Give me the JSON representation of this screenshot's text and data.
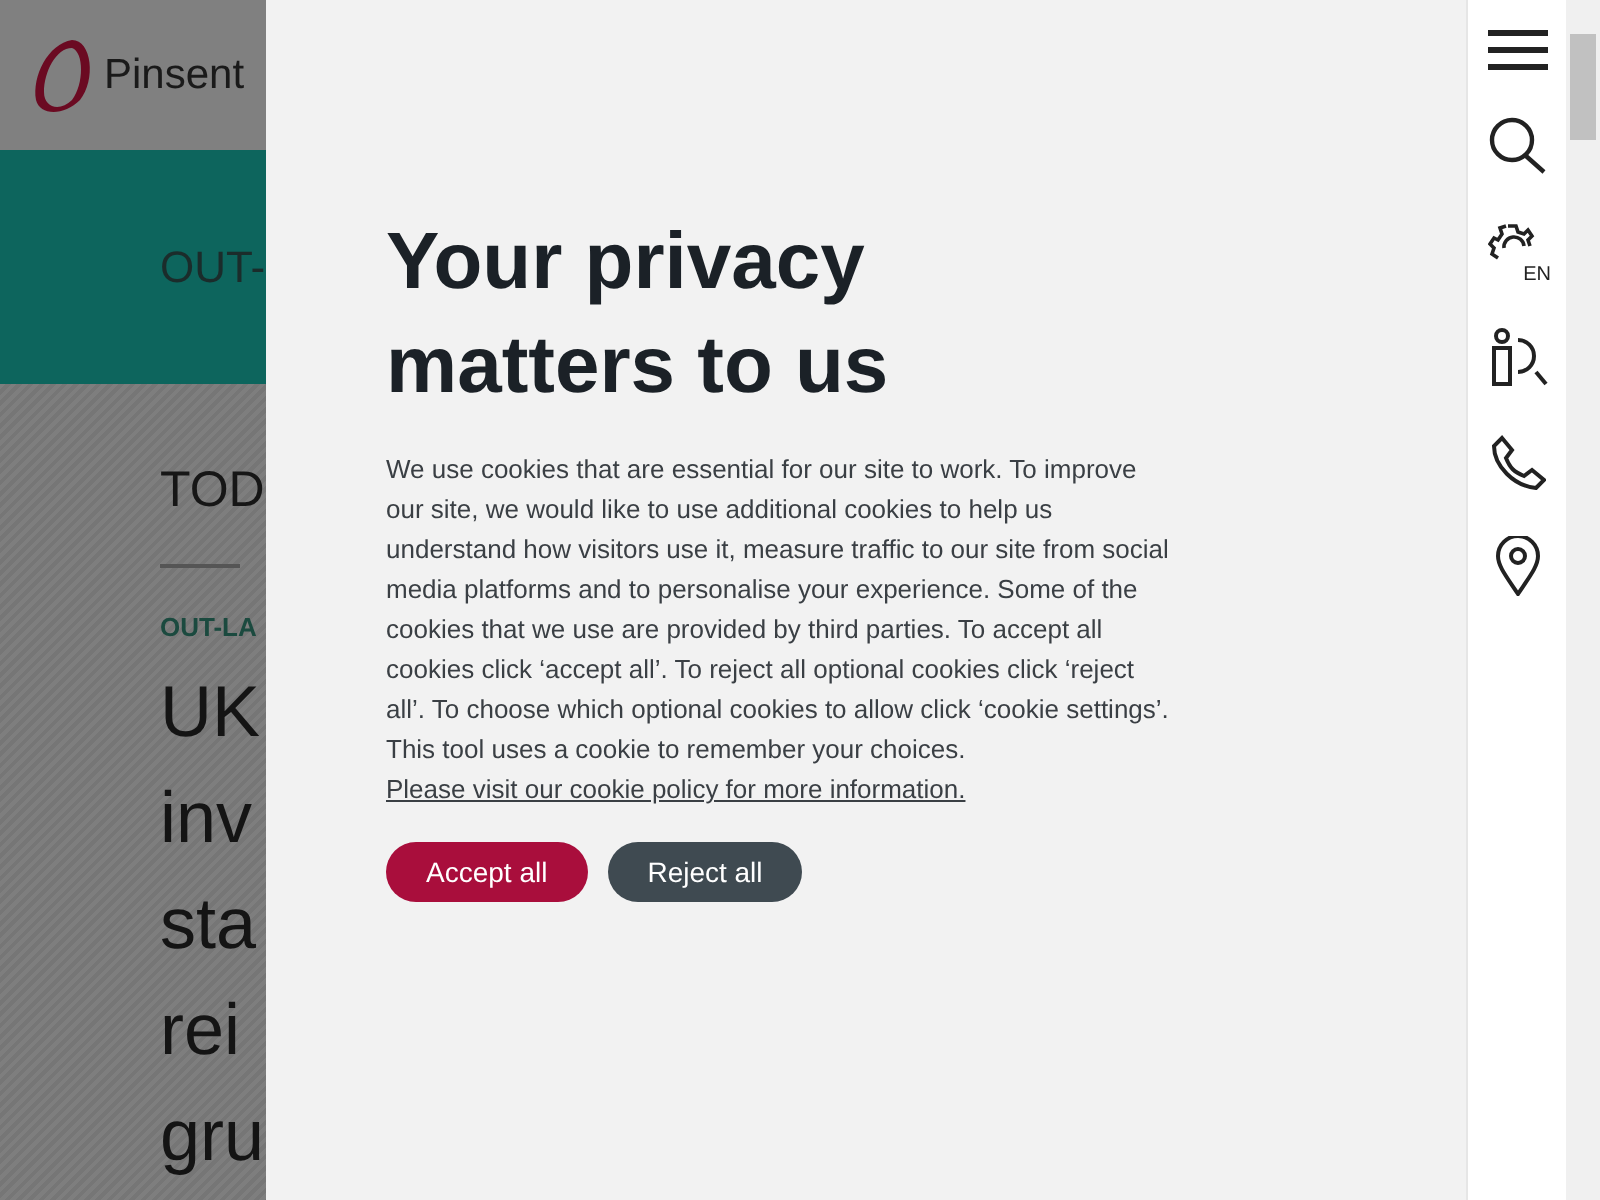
{
  "header": {
    "logo_text": "Pinsent"
  },
  "banner": {
    "title": "OUT-"
  },
  "story": {
    "section_heading": "TOD",
    "category": "OUT-LA",
    "headline_lines": [
      "UK",
      "inv",
      "sta",
      "rei",
      "gru"
    ]
  },
  "cookie_dialog": {
    "title": "Your privacy matters to us",
    "body": "We use cookies that are essential for our site to work. To improve our site, we would like to use additional cookies to help us understand how visitors use it, measure traffic to our site from social media platforms and to personalise your experience. Some of the cookies that we use are provided by third parties. To accept all cookies click ‘accept all’. To reject all optional cookies click ‘reject all’. To choose which optional cookies to allow click ‘cookie settings’. This tool uses a cookie to remember your choices.",
    "link": "Please visit our cookie policy for more information.",
    "buttons": [
      {
        "label": "Accept all",
        "kind": "primary"
      },
      {
        "label": "Reject all",
        "kind": "secondary"
      }
    ]
  },
  "sidebar": {
    "language": "EN"
  }
}
